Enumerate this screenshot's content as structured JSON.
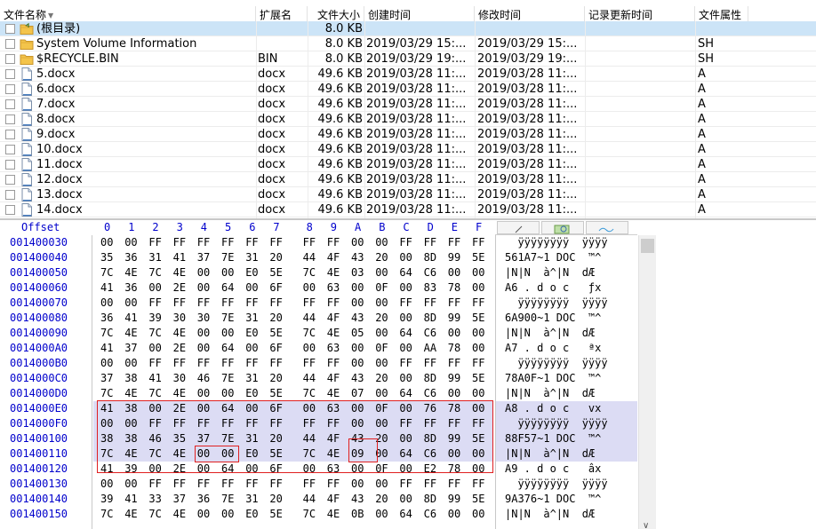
{
  "file_list": {
    "columns": [
      {
        "key": "name",
        "label": "文件名称",
        "sorted": true
      },
      {
        "key": "ext",
        "label": "扩展名"
      },
      {
        "key": "size",
        "label": "文件大小"
      },
      {
        "key": "ctime",
        "label": "创建时间"
      },
      {
        "key": "mtime",
        "label": "修改时间"
      },
      {
        "key": "rtime",
        "label": "记录更新时间"
      },
      {
        "key": "attr",
        "label": "文件属性"
      }
    ],
    "rows": [
      {
        "icon": "folder-up-icon",
        "name": "(根目录)",
        "ext": "",
        "size": "8.0 KB",
        "ctime": "",
        "mtime": "",
        "attr": "",
        "selected": true
      },
      {
        "icon": "folder-icon",
        "name": "System Volume Information",
        "ext": "",
        "size": "8.0 KB",
        "ctime": "2019/03/29  15:...",
        "mtime": "2019/03/29  15:...",
        "attr": "SH"
      },
      {
        "icon": "folder-icon",
        "name": "$RECYCLE.BIN",
        "ext": "BIN",
        "size": "8.0 KB",
        "ctime": "2019/03/29  19:...",
        "mtime": "2019/03/29  19:...",
        "attr": "SH"
      },
      {
        "icon": "file-icon",
        "name": "5.docx",
        "ext": "docx",
        "size": "49.6 KB",
        "ctime": "2019/03/28  11:...",
        "mtime": "2019/03/28  11:...",
        "attr": "A"
      },
      {
        "icon": "file-icon",
        "name": "6.docx",
        "ext": "docx",
        "size": "49.6 KB",
        "ctime": "2019/03/28  11:...",
        "mtime": "2019/03/28  11:...",
        "attr": "A"
      },
      {
        "icon": "file-icon",
        "name": "7.docx",
        "ext": "docx",
        "size": "49.6 KB",
        "ctime": "2019/03/28  11:...",
        "mtime": "2019/03/28  11:...",
        "attr": "A"
      },
      {
        "icon": "file-icon",
        "name": "8.docx",
        "ext": "docx",
        "size": "49.6 KB",
        "ctime": "2019/03/28  11:...",
        "mtime": "2019/03/28  11:...",
        "attr": "A"
      },
      {
        "icon": "file-icon",
        "name": "9.docx",
        "ext": "docx",
        "size": "49.6 KB",
        "ctime": "2019/03/28  11:...",
        "mtime": "2019/03/28  11:...",
        "attr": "A"
      },
      {
        "icon": "file-icon",
        "name": "10.docx",
        "ext": "docx",
        "size": "49.6 KB",
        "ctime": "2019/03/28  11:...",
        "mtime": "2019/03/28  11:...",
        "attr": "A"
      },
      {
        "icon": "file-icon",
        "name": "11.docx",
        "ext": "docx",
        "size": "49.6 KB",
        "ctime": "2019/03/28  11:...",
        "mtime": "2019/03/28  11:...",
        "attr": "A"
      },
      {
        "icon": "file-icon",
        "name": "12.docx",
        "ext": "docx",
        "size": "49.6 KB",
        "ctime": "2019/03/28  11:...",
        "mtime": "2019/03/28  11:...",
        "attr": "A"
      },
      {
        "icon": "file-icon",
        "name": "13.docx",
        "ext": "docx",
        "size": "49.6 KB",
        "ctime": "2019/03/28  11:...",
        "mtime": "2019/03/28  11:...",
        "attr": "A"
      },
      {
        "icon": "file-icon",
        "name": "14.docx",
        "ext": "docx",
        "size": "49.6 KB",
        "ctime": "2019/03/28  11:...",
        "mtime": "2019/03/28  11:...",
        "attr": "A"
      }
    ]
  },
  "hex_view": {
    "offset_label": "Offset",
    "column_labels": [
      "0",
      "1",
      "2",
      "3",
      "4",
      "5",
      "6",
      "7",
      "8",
      "9",
      "A",
      "B",
      "C",
      "D",
      "E",
      "F"
    ],
    "text_tabs": [
      "text-tab-icon",
      "search-tab-icon",
      "wave-tab-icon"
    ],
    "rows": [
      {
        "offset": "001400030",
        "bytes": [
          "00",
          "00",
          "FF",
          "FF",
          "FF",
          "FF",
          "FF",
          "FF",
          "FF",
          "FF",
          "00",
          "00",
          "FF",
          "FF",
          "FF",
          "FF"
        ],
        "text": "  ÿÿÿÿÿÿÿÿ  ÿÿÿÿ"
      },
      {
        "offset": "001400040",
        "bytes": [
          "35",
          "36",
          "31",
          "41",
          "37",
          "7E",
          "31",
          "20",
          "44",
          "4F",
          "43",
          "20",
          "00",
          "8D",
          "99",
          "5E"
        ],
        "text": "561A7~1 DOC  ™^"
      },
      {
        "offset": "001400050",
        "bytes": [
          "7C",
          "4E",
          "7C",
          "4E",
          "00",
          "00",
          "E0",
          "5E",
          "7C",
          "4E",
          "03",
          "00",
          "64",
          "C6",
          "00",
          "00"
        ],
        "text": "|N|N  à^|N  dÆ"
      },
      {
        "offset": "001400060",
        "bytes": [
          "41",
          "36",
          "00",
          "2E",
          "00",
          "64",
          "00",
          "6F",
          "00",
          "63",
          "00",
          "0F",
          "00",
          "83",
          "78",
          "00"
        ],
        "text": "A6 . d o c   ƒx"
      },
      {
        "offset": "001400070",
        "bytes": [
          "00",
          "00",
          "FF",
          "FF",
          "FF",
          "FF",
          "FF",
          "FF",
          "FF",
          "FF",
          "00",
          "00",
          "FF",
          "FF",
          "FF",
          "FF"
        ],
        "text": "  ÿÿÿÿÿÿÿÿ  ÿÿÿÿ"
      },
      {
        "offset": "001400080",
        "bytes": [
          "36",
          "41",
          "39",
          "30",
          "30",
          "7E",
          "31",
          "20",
          "44",
          "4F",
          "43",
          "20",
          "00",
          "8D",
          "99",
          "5E"
        ],
        "text": "6A900~1 DOC  ™^"
      },
      {
        "offset": "001400090",
        "bytes": [
          "7C",
          "4E",
          "7C",
          "4E",
          "00",
          "00",
          "E0",
          "5E",
          "7C",
          "4E",
          "05",
          "00",
          "64",
          "C6",
          "00",
          "00"
        ],
        "text": "|N|N  à^|N  dÆ"
      },
      {
        "offset": "0014000A0",
        "bytes": [
          "41",
          "37",
          "00",
          "2E",
          "00",
          "64",
          "00",
          "6F",
          "00",
          "63",
          "00",
          "0F",
          "00",
          "AA",
          "78",
          "00"
        ],
        "text": "A7 . d o c   ªx"
      },
      {
        "offset": "0014000B0",
        "bytes": [
          "00",
          "00",
          "FF",
          "FF",
          "FF",
          "FF",
          "FF",
          "FF",
          "FF",
          "FF",
          "00",
          "00",
          "FF",
          "FF",
          "FF",
          "FF"
        ],
        "text": "  ÿÿÿÿÿÿÿÿ  ÿÿÿÿ"
      },
      {
        "offset": "0014000C0",
        "bytes": [
          "37",
          "38",
          "41",
          "30",
          "46",
          "7E",
          "31",
          "20",
          "44",
          "4F",
          "43",
          "20",
          "00",
          "8D",
          "99",
          "5E"
        ],
        "text": "78A0F~1 DOC  ™^"
      },
      {
        "offset": "0014000D0",
        "bytes": [
          "7C",
          "4E",
          "7C",
          "4E",
          "00",
          "00",
          "E0",
          "5E",
          "7C",
          "4E",
          "07",
          "00",
          "64",
          "C6",
          "00",
          "00"
        ],
        "text": "|N|N  à^|N  dÆ"
      },
      {
        "offset": "0014000E0",
        "bytes": [
          "41",
          "38",
          "00",
          "2E",
          "00",
          "64",
          "00",
          "6F",
          "00",
          "63",
          "00",
          "0F",
          "00",
          "76",
          "78",
          "00"
        ],
        "text": "A8 . d o c   vx",
        "highlight": true
      },
      {
        "offset": "0014000F0",
        "bytes": [
          "00",
          "00",
          "FF",
          "FF",
          "FF",
          "FF",
          "FF",
          "FF",
          "FF",
          "FF",
          "00",
          "00",
          "FF",
          "FF",
          "FF",
          "FF"
        ],
        "text": "  ÿÿÿÿÿÿÿÿ  ÿÿÿÿ",
        "highlight": true
      },
      {
        "offset": "001400100",
        "bytes": [
          "38",
          "38",
          "46",
          "35",
          "37",
          "7E",
          "31",
          "20",
          "44",
          "4F",
          "43",
          "20",
          "00",
          "8D",
          "99",
          "5E"
        ],
        "text": "88F57~1 DOC  ™^",
        "highlight": true
      },
      {
        "offset": "001400110",
        "bytes": [
          "7C",
          "4E",
          "7C",
          "4E",
          "00",
          "00",
          "E0",
          "5E",
          "7C",
          "4E",
          "09",
          "00",
          "64",
          "C6",
          "00",
          "00"
        ],
        "text": "|N|N  à^|N  dÆ",
        "highlight": true
      },
      {
        "offset": "001400120",
        "bytes": [
          "41",
          "39",
          "00",
          "2E",
          "00",
          "64",
          "00",
          "6F",
          "00",
          "63",
          "00",
          "0F",
          "00",
          "E2",
          "78",
          "00"
        ],
        "text": "A9 . d o c   âx"
      },
      {
        "offset": "001400130",
        "bytes": [
          "00",
          "00",
          "FF",
          "FF",
          "FF",
          "FF",
          "FF",
          "FF",
          "FF",
          "FF",
          "00",
          "00",
          "FF",
          "FF",
          "FF",
          "FF"
        ],
        "text": "  ÿÿÿÿÿÿÿÿ  ÿÿÿÿ"
      },
      {
        "offset": "001400140",
        "bytes": [
          "39",
          "41",
          "33",
          "37",
          "36",
          "7E",
          "31",
          "20",
          "44",
          "4F",
          "43",
          "20",
          "00",
          "8D",
          "99",
          "5E"
        ],
        "text": "9A376~1 DOC  ™^"
      },
      {
        "offset": "001400150",
        "bytes": [
          "7C",
          "4E",
          "7C",
          "4E",
          "00",
          "00",
          "E0",
          "5E",
          "7C",
          "4E",
          "0B",
          "00",
          "64",
          "C6",
          "00",
          "00"
        ],
        "text": "|N|N  à^|N  dÆ"
      }
    ]
  },
  "colors": {
    "selection": "#cce4f7",
    "hex_highlight": "#dcdcf4",
    "offset_text": "#0000cc",
    "annotation": "#e02020",
    "folder": "#f3c44b"
  }
}
